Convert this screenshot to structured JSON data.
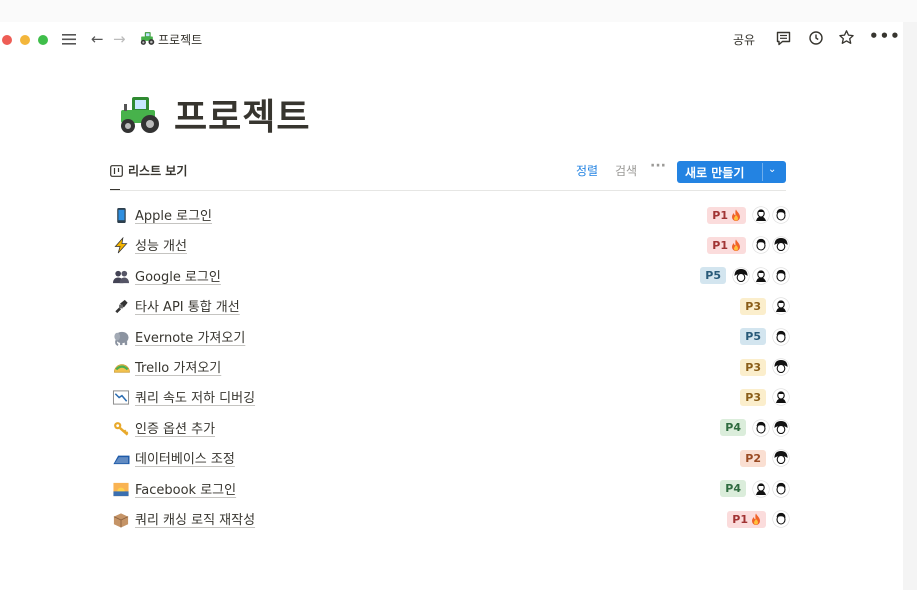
{
  "topbar": {
    "breadcrumb": "프로젝트",
    "share_label": "공유"
  },
  "page": {
    "title": "프로젝트"
  },
  "view": {
    "tab_label": "리스트 보기",
    "sort_label": "정렬",
    "search_label": "검색",
    "more_label": "···",
    "new_label": "새로 만들기"
  },
  "colors": {
    "accent": "#2383e2",
    "P1_bg": "#fbdcdc",
    "P1_fg": "#a13333",
    "P2_bg": "#fadfd2",
    "P2_fg": "#9a4a22",
    "P3_bg": "#fbeecc",
    "P3_fg": "#8a5d18",
    "P4_bg": "#dbeddb",
    "P4_fg": "#2f6b3f",
    "P5_bg": "#d3e5ef",
    "P5_fg": "#285a79"
  },
  "rows": [
    {
      "icon": "mobile-phone-icon",
      "title": "Apple 로그인",
      "priority": "P1",
      "fire": true,
      "avatars": 2
    },
    {
      "icon": "lightning-icon",
      "title": "성능 개선",
      "priority": "P1",
      "fire": true,
      "avatars": 2
    },
    {
      "icon": "people-icon",
      "title": "Google 로그인",
      "priority": "P5",
      "fire": false,
      "avatars": 3
    },
    {
      "icon": "plug-icon",
      "title": "타사 API 통합 개선",
      "priority": "P3",
      "fire": false,
      "avatars": 1
    },
    {
      "icon": "elephant-icon",
      "title": "Evernote 가져오기",
      "priority": "P5",
      "fire": false,
      "avatars": 1
    },
    {
      "icon": "taco-icon",
      "title": "Trello 가져오기",
      "priority": "P3",
      "fire": false,
      "avatars": 1
    },
    {
      "icon": "chart-down-icon",
      "title": "쿼리 속도 저하 디버깅",
      "priority": "P3",
      "fire": false,
      "avatars": 1
    },
    {
      "icon": "key-icon",
      "title": "인증 옵션 추가",
      "priority": "P4",
      "fire": false,
      "avatars": 2
    },
    {
      "icon": "roof-icon",
      "title": "데이터베이스 조정",
      "priority": "P2",
      "fire": false,
      "avatars": 1
    },
    {
      "icon": "sunrise-icon",
      "title": "Facebook 로그인",
      "priority": "P4",
      "fire": false,
      "avatars": 2
    },
    {
      "icon": "box-icon",
      "title": "쿼리 캐싱 로직 재작성",
      "priority": "P1",
      "fire": true,
      "avatars": 1
    }
  ]
}
